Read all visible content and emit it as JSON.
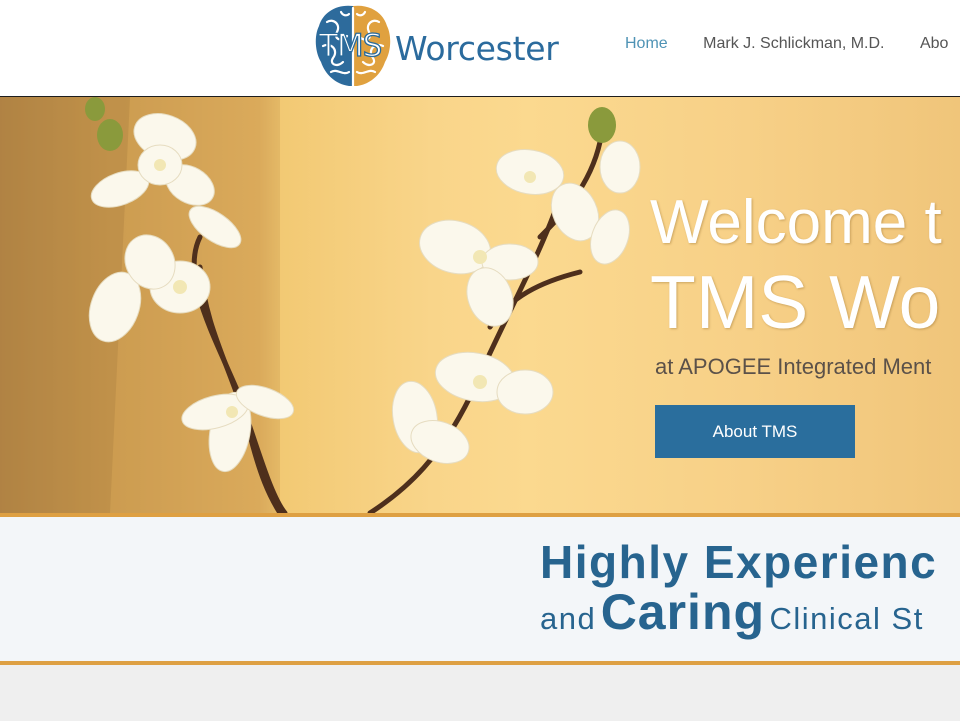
{
  "header": {
    "logo": {
      "tms": "TMS",
      "word": "Worcester"
    },
    "nav": [
      {
        "label": "Home",
        "active": true
      },
      {
        "label": "Mark J. Schlickman, M.D.",
        "active": false
      },
      {
        "label": "Abo",
        "active": false
      }
    ]
  },
  "hero": {
    "title_line1": "Welcome t",
    "title_line2": "TMS Wo",
    "subtitle": "at APOGEE Integrated Ment",
    "button_label": "About TMS"
  },
  "band": {
    "line1": "Highly Experienc",
    "line2_and": "and",
    "line2_caring": "Caring",
    "line2_rest": "Clinical St"
  },
  "colors": {
    "brand_blue": "#2a6e9d",
    "accent_orange": "#dea043",
    "nav_active": "#4f93b5",
    "brain_left": "#2d6b9c",
    "brain_right": "#e0a13f"
  }
}
